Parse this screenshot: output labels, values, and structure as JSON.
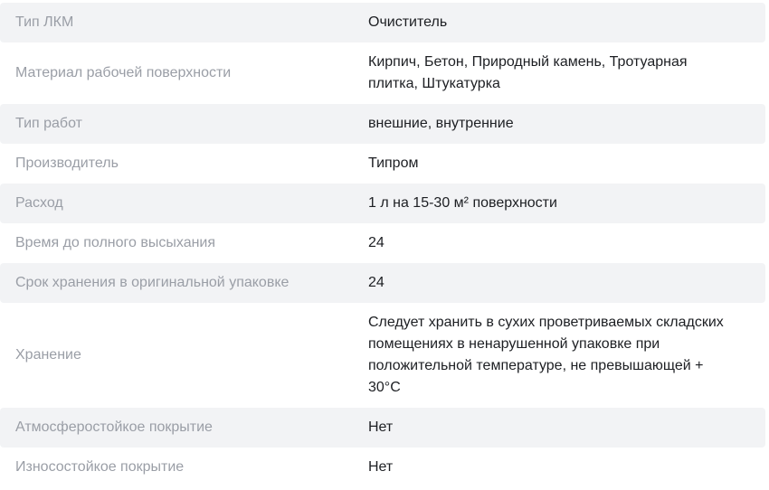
{
  "specs": [
    {
      "label": "Тип ЛКМ",
      "value": "Очиститель"
    },
    {
      "label": "Материал рабочей поверхности",
      "value": "Кирпич, Бетон, Природный камень, Тротуарная плитка, Штукатурка"
    },
    {
      "label": "Тип работ",
      "value": "внешние, внутренние"
    },
    {
      "label": "Производитель",
      "value": "Типром"
    },
    {
      "label": "Расход",
      "value": "1 л на 15-30 м² поверхности"
    },
    {
      "label": "Время до полного высыхания",
      "value": "24"
    },
    {
      "label": "Срок хранения в оригинальной упаковке",
      "value": "24"
    },
    {
      "label": "Хранение",
      "value": "Следует хранить в сухих проветриваемых складских помещениях в ненарушенной упаковке при положительной температуре, не превышающей + 30°C"
    },
    {
      "label": "Атмосферостойкое покрытие",
      "value": "Нет"
    },
    {
      "label": "Износостойкое покрытие",
      "value": "Нет"
    }
  ]
}
